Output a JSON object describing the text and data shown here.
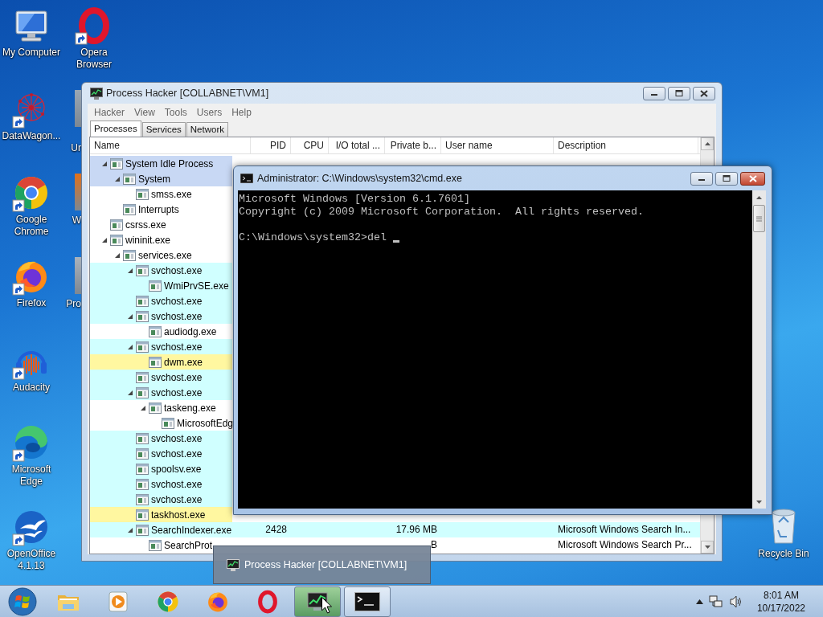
{
  "desktop_icons": [
    {
      "label": "My Computer",
      "kind": "computer"
    },
    {
      "label": "DataWagon...",
      "kind": "datawagon"
    },
    {
      "label": "Google Chrome",
      "kind": "chrome"
    },
    {
      "label": "Firefox",
      "kind": "firefox"
    },
    {
      "label": "Audacity",
      "kind": "audacity"
    },
    {
      "label": "Microsoft Edge",
      "kind": "edge"
    },
    {
      "label": "OpenOffice 4.1.13",
      "kind": "openoffice"
    },
    {
      "label": "Opera Browser",
      "kind": "opera"
    }
  ],
  "covered_icons": [
    {
      "label": "Ur"
    },
    {
      "label": "W"
    },
    {
      "label": "Pro"
    }
  ],
  "recycle_bin": {
    "label": "Recycle Bin"
  },
  "process_hacker": {
    "title": "Process Hacker [COLLABNET\\VM1]",
    "menu": [
      "Hacker",
      "View",
      "Tools",
      "Users",
      "Help"
    ],
    "tabs": [
      {
        "label": "Processes",
        "selected": true
      },
      {
        "label": "Services",
        "selected": false
      },
      {
        "label": "Network",
        "selected": false
      }
    ],
    "columns": [
      "Name",
      "PID",
      "CPU",
      "I/O total ...",
      "Private b...",
      "User name",
      "Description"
    ],
    "rows": [
      {
        "name": "System Idle Process",
        "color": "#c8d8f4",
        "expanded": true,
        "children": [
          {
            "name": "System",
            "color": "#c8d8f4",
            "expanded": true,
            "children": [
              {
                "name": "smss.exe",
                "color": "#ffffff"
              }
            ]
          },
          {
            "name": "Interrupts",
            "color": "#ffffff"
          }
        ]
      },
      {
        "name": "csrss.exe",
        "color": "#ffffff"
      },
      {
        "name": "wininit.exe",
        "color": "#ffffff",
        "expanded": true,
        "children": [
          {
            "name": "services.exe",
            "color": "#ffffff",
            "expanded": true,
            "children": [
              {
                "name": "svchost.exe",
                "color": "#d0ffff",
                "expanded": true,
                "children": [
                  {
                    "name": "WmiPrvSE.exe",
                    "color": "#d0ffff"
                  }
                ]
              },
              {
                "name": "svchost.exe",
                "color": "#d0ffff"
              },
              {
                "name": "svchost.exe",
                "color": "#d0ffff",
                "expanded": true,
                "children": [
                  {
                    "name": "audiodg.exe",
                    "color": "#ffffff"
                  }
                ]
              },
              {
                "name": "svchost.exe",
                "color": "#d0ffff",
                "expanded": true,
                "children": [
                  {
                    "name": "dwm.exe",
                    "color": "#fff7a0"
                  }
                ]
              },
              {
                "name": "svchost.exe",
                "color": "#d0ffff"
              },
              {
                "name": "svchost.exe",
                "color": "#d0ffff",
                "expanded": true,
                "children": [
                  {
                    "name": "taskeng.exe",
                    "color": "#ffffff",
                    "expanded": true,
                    "children": [
                      {
                        "name": "MicrosoftEdg",
                        "color": "#ffffff"
                      }
                    ]
                  }
                ]
              },
              {
                "name": "svchost.exe",
                "color": "#d0ffff"
              },
              {
                "name": "svchost.exe",
                "color": "#d0ffff"
              },
              {
                "name": "spoolsv.exe",
                "color": "#d0ffff"
              },
              {
                "name": "svchost.exe",
                "color": "#d0ffff"
              },
              {
                "name": "svchost.exe",
                "color": "#d0ffff"
              },
              {
                "name": "taskhost.exe",
                "color": "#fff7a0"
              },
              {
                "name": "SearchIndexer.exe",
                "color": "#d0ffff",
                "expanded": true,
                "pid": "2428",
                "private_bytes": "17.96 MB",
                "description": "Microsoft Windows Search In...",
                "children": [
                  {
                    "name": "SearchProt",
                    "color": "#ffffff",
                    "private_bytes": "B",
                    "description": "Microsoft Windows Search Pr..."
                  }
                ]
              }
            ]
          }
        ]
      }
    ]
  },
  "cmd_window": {
    "title": "Administrator: C:\\Windows\\system32\\cmd.exe",
    "output": [
      "Microsoft Windows [Version 6.1.7601]",
      "Copyright (c) 2009 Microsoft Corporation.  All rights reserved."
    ],
    "prompt": "C:\\Windows\\system32>del"
  },
  "taskbar_preview": {
    "title": "Process Hacker [COLLABNET\\VM1]"
  },
  "taskbar": {
    "buttons": [
      {
        "kind": "explorer",
        "open": false,
        "hovered": false
      },
      {
        "kind": "media",
        "open": false,
        "hovered": false
      },
      {
        "kind": "chrome",
        "open": false,
        "hovered": false
      },
      {
        "kind": "firefox",
        "open": false,
        "hovered": false
      },
      {
        "kind": "opera",
        "open": false,
        "hovered": false
      },
      {
        "kind": "processhacker",
        "open": true,
        "hovered": true
      },
      {
        "kind": "cmd",
        "open": true,
        "hovered": false
      }
    ],
    "time": "8:01 AM",
    "date": "10/17/2022"
  }
}
